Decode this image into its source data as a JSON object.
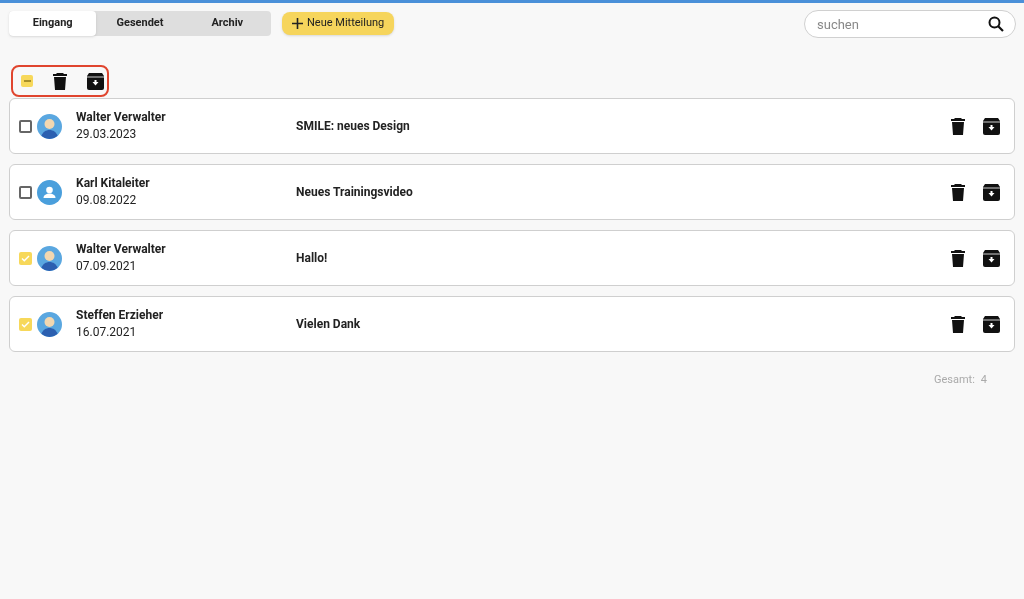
{
  "tabs": [
    {
      "label": "Eingang",
      "selected": true
    },
    {
      "label": "Gesendet",
      "selected": false
    },
    {
      "label": "Archiv",
      "selected": false
    }
  ],
  "new_button": {
    "label": "Neue Mitteilung"
  },
  "search": {
    "placeholder": "suchen"
  },
  "bulk_toolbar": {
    "select_all_indeterminate": true
  },
  "messages": [
    {
      "sender": "Walter Verwalter",
      "date": "29.03.2023",
      "subject": "SMILE: neues Design",
      "checked": false,
      "kind": "picture-avatar"
    },
    {
      "sender": "Karl Kitaleiter",
      "date": "09.08.2022",
      "subject": "Neues Trainingsvideo",
      "checked": false,
      "kind": "default-avatar"
    },
    {
      "sender": "Walter Verwalter",
      "date": "07.09.2021",
      "subject": "Hallo!",
      "checked": true,
      "kind": "picture-avatar"
    },
    {
      "sender": "Steffen Erzieher",
      "date": "16.07.2021",
      "subject": "Vielen Dank",
      "checked": true,
      "kind": "picture-avatar"
    }
  ],
  "footer": {
    "label": "Gesamt:",
    "count": "4"
  }
}
